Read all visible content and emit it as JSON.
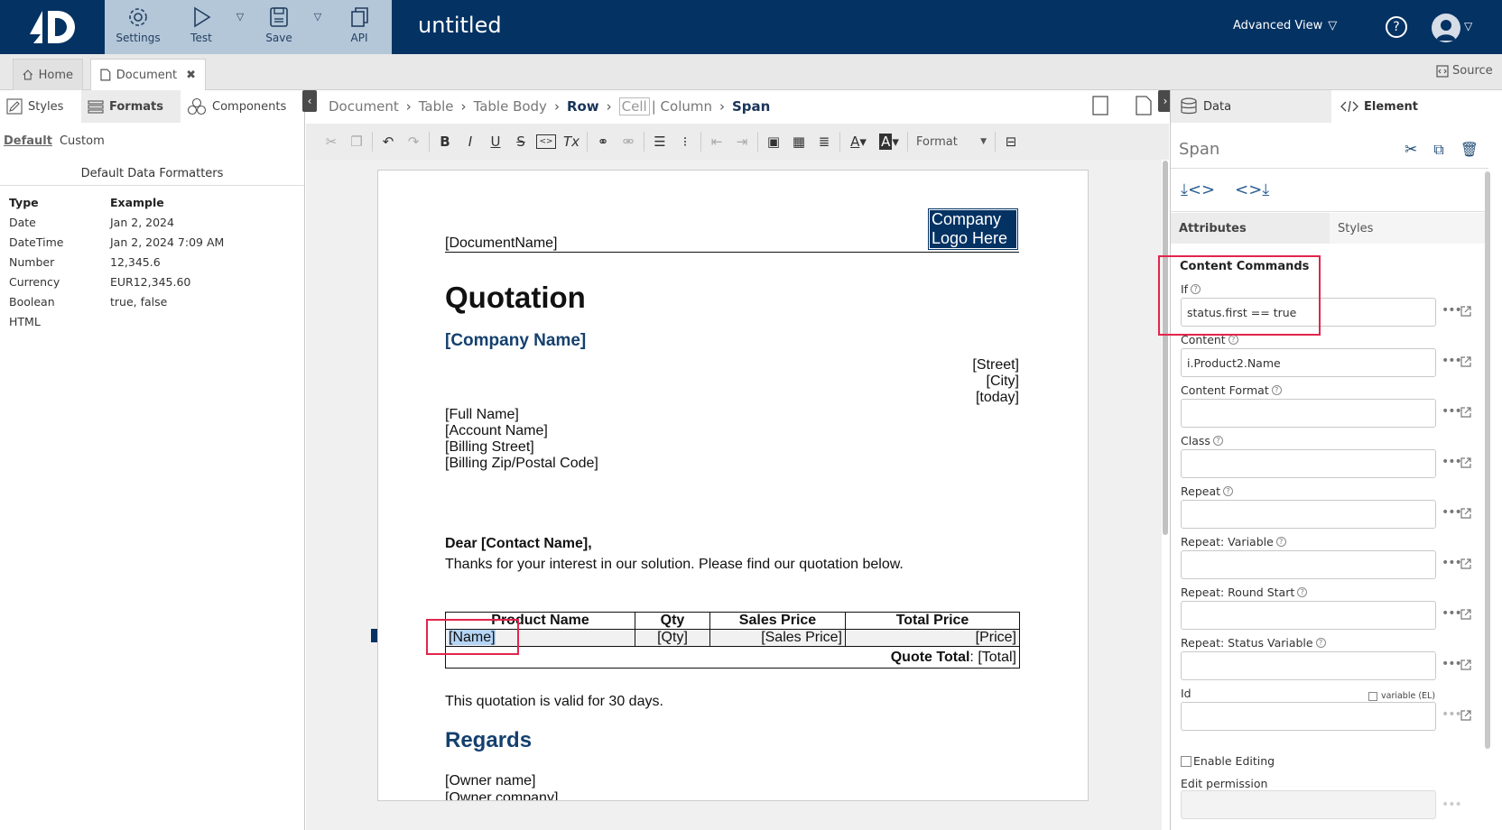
{
  "topbar": {
    "buttons": [
      {
        "label": "Settings",
        "icon": "gear-icon"
      },
      {
        "label": "Test",
        "icon": "play-icon"
      },
      {
        "label": "Save",
        "icon": "save-icon"
      },
      {
        "label": "API",
        "icon": "copy-icon"
      }
    ],
    "doc_title": "untitled",
    "view_label": "Advanced View",
    "help": "?"
  },
  "tabs": {
    "home": "Home",
    "document": "Document",
    "source": "Source"
  },
  "left": {
    "tabs": [
      "Styles",
      "Formats",
      "Components"
    ],
    "link_default": "Default",
    "link_custom": "Custom",
    "title": "Default Data Formatters",
    "header": [
      "Type",
      "Example"
    ],
    "rows": [
      [
        "Date",
        "Jan 2, 2024"
      ],
      [
        "DateTime",
        "Jan 2, 2024 7:09 AM"
      ],
      [
        "Number",
        "12,345.6"
      ],
      [
        "Currency",
        "EUR12,345.60"
      ],
      [
        "Boolean",
        "true, false"
      ],
      [
        "HTML",
        ""
      ]
    ]
  },
  "breadcrumb": {
    "document": "Document",
    "table": "Table",
    "table_body": "Table Body",
    "row": "Row",
    "cell": "Cell",
    "column": "| Column",
    "span": "Span"
  },
  "toolbar": {
    "format_label": "Format"
  },
  "doc": {
    "logo_line1": "Company",
    "logo_line2": "Logo Here",
    "docname": "[DocumentName]",
    "title": "Quotation",
    "company": "[Company Name]",
    "street": "[Street]",
    "city": "[City]",
    "today": "[today]",
    "full_name": "[Full Name]",
    "account_name": "[Account Name]",
    "billing_street": "[Billing Street]",
    "billing_zip": "[Billing Zip/Postal Code]",
    "dear": "Dear [Contact Name],",
    "thanks": "Thanks for your interest in our solution. Please find our quotation below.",
    "table_headers": [
      "Product Name",
      "Qty",
      "Sales Price",
      "Total Price"
    ],
    "row_name": "[Name]",
    "row_qty": "[Qty]",
    "row_sales": "[Sales Price]",
    "row_price": "[Price]",
    "quote_total_label": "Quote Total",
    "quote_total_value": ": [Total]",
    "valid": "This quotation is valid for 30 days.",
    "regards": "Regards",
    "owner_name": "[Owner name]",
    "owner_company": "[Owner company]"
  },
  "right": {
    "tabs": [
      "Data",
      "Element"
    ],
    "element_title": "Span",
    "subtabs": [
      "Attributes",
      "Styles"
    ],
    "section": "Content Commands",
    "fields": [
      {
        "label": "If",
        "value": "status.first == true"
      },
      {
        "label": "Content",
        "value": "i.Product2.Name"
      },
      {
        "label": "Content Format",
        "value": ""
      },
      {
        "label": "Class",
        "value": ""
      },
      {
        "label": "Repeat",
        "value": ""
      },
      {
        "label": "Repeat: Variable",
        "value": ""
      },
      {
        "label": "Repeat: Round Start",
        "value": ""
      },
      {
        "label": "Repeat: Status Variable",
        "value": ""
      },
      {
        "label": "Id",
        "value": ""
      }
    ],
    "variable_label": "variable (EL)",
    "enable_editing": "Enable Editing",
    "edit_permission": "Edit permission"
  },
  "colors": {
    "brand": "#043263",
    "accent_light": "#b3c7d9",
    "highlight_red": "#e2254d",
    "heading_blue": "#14406e"
  }
}
